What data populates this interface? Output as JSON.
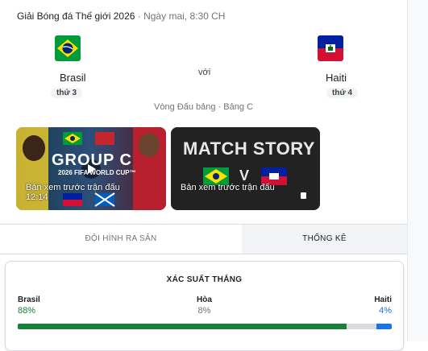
{
  "header": {
    "tournament": "Giải Bóng đá Thế giới 2026",
    "separator": " · ",
    "time": "Ngày mai, 8:30 CH"
  },
  "match": {
    "home": {
      "name": "Brasil",
      "rank": "thứ 3",
      "flag_icon": "brazil-flag-icon"
    },
    "vs_label": "với",
    "away": {
      "name": "Haiti",
      "rank": "thứ 4",
      "flag_icon": "haiti-flag-icon"
    },
    "stage": "Vòng Đấu bảng · Bảng C"
  },
  "videos": [
    {
      "title": "Bản xem trước trận đấu",
      "duration": "12:14",
      "overlay_text": "GROUP C",
      "overlay_sub": "2026 FIFA WORLD CUP™"
    },
    {
      "title": "Bản xem trước trận đấu",
      "overlay_text": "MATCH STORY",
      "overlay_vs": "V"
    }
  ],
  "tabs": [
    {
      "label": "ĐỘI HÌNH RA SÂN",
      "selected": false
    },
    {
      "label": "THỐNG KÊ",
      "selected": true
    }
  ],
  "win_probability": {
    "title": "XÁC SUẤT THẮNG",
    "home": {
      "label": "Brasil",
      "value": "88%",
      "fraction": 0.88,
      "color": "#188038"
    },
    "draw": {
      "label": "Hòa",
      "value": "8%",
      "fraction": 0.08,
      "color": "#dadce0"
    },
    "away": {
      "label": "Haiti",
      "value": "4%",
      "fraction": 0.04,
      "color": "#1a73e8"
    }
  }
}
